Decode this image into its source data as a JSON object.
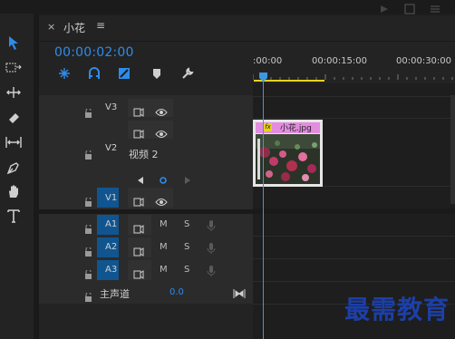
{
  "panel": {
    "close_glyph": "×",
    "title": "小花",
    "menu_glyph": "≡"
  },
  "timecode": "00:00:02:00",
  "ruler": {
    "labels": [
      ":00:00",
      "00:00:15:00",
      "00:00:30:00"
    ]
  },
  "tracks": {
    "v3": {
      "label": "V3"
    },
    "v2": {
      "label": "V2",
      "name": "视频 2"
    },
    "v1": {
      "label": "V1",
      "source": "V1"
    },
    "a1": {
      "label": "A1",
      "mute": "M",
      "solo": "S"
    },
    "a2": {
      "label": "A2",
      "mute": "M",
      "solo": "S"
    },
    "a3": {
      "label": "A3",
      "mute": "M",
      "solo": "S"
    },
    "master": {
      "label": "主声道",
      "value": "0.0"
    }
  },
  "clip": {
    "fx_label": "fx",
    "name": "小花.jpg"
  },
  "watermark": "最需教育",
  "colors": {
    "accent": "#2d8ceb",
    "track_target": "#10558f",
    "clip_label": "#e38ce0",
    "work_area": "#e6d21e",
    "watermark": "#1c3fa8"
  }
}
